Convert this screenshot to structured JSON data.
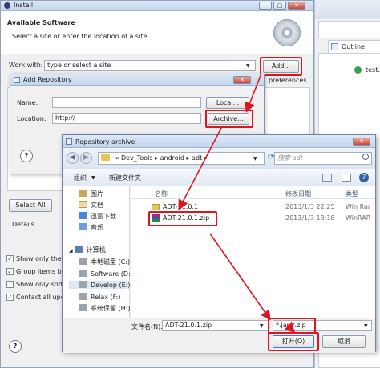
{
  "install": {
    "title": "Install",
    "header_title": "Available Software",
    "header_subtitle": "Select a site or enter the location of a site.",
    "work_with_label": "Work with:",
    "work_with_value": "type or select a site",
    "add_button": "Add...",
    "find_more_suffix": "preferences.",
    "select_all": "Select All",
    "details_label": "Details",
    "checkboxes": [
      {
        "label": "Show only the",
        "checked": true
      },
      {
        "label": "Group items by",
        "checked": true
      },
      {
        "label": "Show only softw",
        "checked": false
      },
      {
        "label": "Contact all upd",
        "checked": true
      }
    ],
    "help_icon": "?"
  },
  "eclipse": {
    "outline_tab": "Outline",
    "outline_item": "test."
  },
  "add_repo": {
    "title": "Add Repository",
    "name_label": "Name:",
    "name_value": "",
    "location_label": "Location:",
    "location_value": "http://",
    "local_button": "Local...",
    "archive_button": "Archive...",
    "help_icon": "?"
  },
  "archive": {
    "title": "Repository archive",
    "path": [
      "Dev_Tools",
      "android",
      "adt"
    ],
    "search_placeholder": "搜索 adt",
    "organize": "组织",
    "new_folder": "新建文件夹",
    "sidebar": [
      {
        "label": "图片",
        "icon": "pictures-icon"
      },
      {
        "label": "文档",
        "icon": "documents-icon"
      },
      {
        "label": "迅雷下载",
        "icon": "thunder-download-icon"
      },
      {
        "label": "音乐",
        "icon": "music-icon"
      },
      {
        "label": "计算机",
        "icon": "computer-icon"
      },
      {
        "label": "本地磁盘 (C:)",
        "icon": "drive-icon"
      },
      {
        "label": "Software (D:)",
        "icon": "drive-icon"
      },
      {
        "label": "Develop (E:)",
        "icon": "drive-icon"
      },
      {
        "label": "Relax (F:)",
        "icon": "drive-icon"
      },
      {
        "label": "系统保留 (H:)",
        "icon": "drive-icon"
      }
    ],
    "columns": {
      "name": "名称",
      "date": "修改日期",
      "type": "类型"
    },
    "files": [
      {
        "name": "ADT-21.0.1",
        "date": "2013/1/3 22:25",
        "type": "Win Rar",
        "icon": "folder-icon"
      },
      {
        "name": "ADT-21.0.1.zip",
        "date": "2013/1/3 13:18",
        "type": "WinRAR",
        "icon": "winrar-zip-icon"
      }
    ],
    "filename_label": "文件名(N):",
    "filename_value": "ADT-21.0.1.zip",
    "filter_value": "*.jar;*.zip",
    "open_button": "打开(O)",
    "cancel_button": "取消"
  },
  "colors": {
    "highlight": "#e0141e",
    "accent": "#2f64a8"
  }
}
